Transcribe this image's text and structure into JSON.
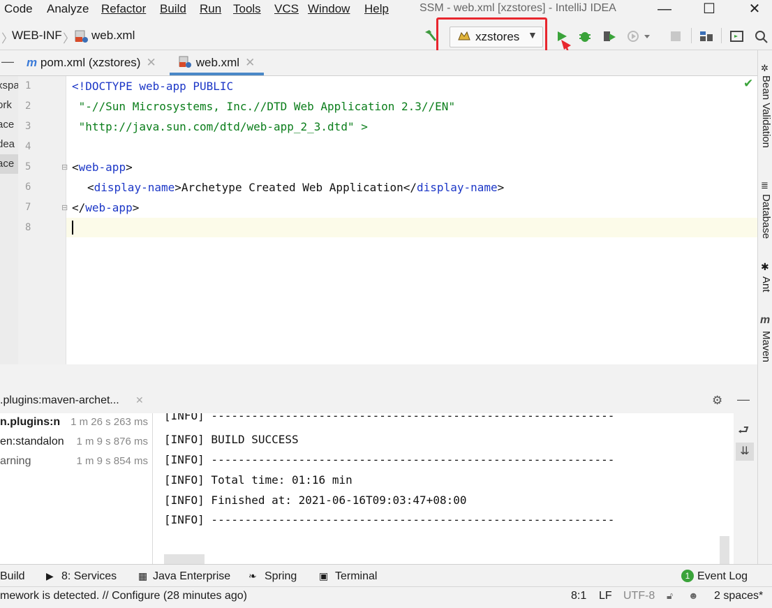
{
  "menu": {
    "code": "Code",
    "analyze": "Analyze",
    "refactor": "Refactor",
    "build": "Build",
    "run": "Run",
    "tools": "Tools",
    "vcs": "VCS",
    "window": "Window",
    "help": "Help"
  },
  "window_title": "SSM - web.xml [xzstores] - IntelliJ IDEA",
  "breadcrumbs": [
    "WEB-INF",
    "web.xml"
  ],
  "run_config": "xzstores",
  "tabs": [
    {
      "label": "pom.xml (xzstores)"
    },
    {
      "label": "web.xml"
    }
  ],
  "left_panel_fragments": [
    "xspa",
    "ork",
    "ace",
    "dea",
    "ace"
  ],
  "line_numbers": [
    "1",
    "2",
    "3",
    "4",
    "5",
    "6",
    "7",
    "8"
  ],
  "code": {
    "l1": "<!DOCTYPE web-app PUBLIC",
    "l2": " \"-//Sun Microsystems, Inc.//DTD Web Application 2.3//EN\"",
    "l3": " \"http://java.sun.com/dtd/web-app_2_3.dtd\" >",
    "l5_open": "<",
    "l5_tag": "web-app",
    "l5_close": ">",
    "l6_open": "<",
    "l6_tag": "display-name",
    "l6_close": ">",
    "l6_text": "Archetype Created Web Application",
    "l6_end_open": "</",
    "l6_end_tag": "display-name",
    "l6_end_close": ">",
    "l7_open": "</",
    "l7_tag": "web-app",
    "l7_close": ">"
  },
  "right_tools": [
    "Bean Validation",
    "Database",
    "Ant",
    "Maven"
  ],
  "run_tab": ".plugins:maven-archet...",
  "run_tree": [
    {
      "label": "n.plugins:n",
      "duration": "1 m 26 s 263 ms"
    },
    {
      "label": "en:standalon",
      "duration": "1 m 9 s 876 ms"
    },
    {
      "label": "arning",
      "duration": "1 m 9 s 854 ms"
    }
  ],
  "console_lines": [
    "[INFO] ------------------------------------------------------------",
    "[INFO] BUILD SUCCESS",
    "[INFO] ------------------------------------------------------------",
    "[INFO] Total time: 01:16 min",
    "[INFO] Finished at: 2021-06-16T09:03:47+08:00",
    "[INFO] ------------------------------------------------------------"
  ],
  "bottom_tools": {
    "build": "Build",
    "services": "8: Services",
    "java_enterprise": "Java Enterprise",
    "spring": "Spring",
    "terminal": "Terminal",
    "event_log": "Event Log",
    "event_count": "1"
  },
  "status": {
    "message": "mework is detected. // Configure (28 minutes ago)",
    "position": "8:1",
    "line_sep": "LF",
    "encoding": "UTF-8",
    "indent": "2 spaces*"
  }
}
